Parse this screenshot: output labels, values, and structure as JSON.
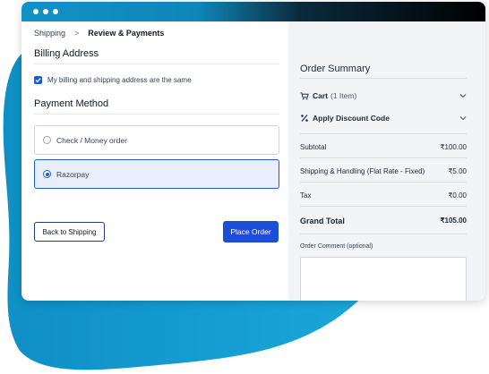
{
  "breadcrumb": {
    "step1": "Shipping",
    "separator": ">",
    "current": "Review & Payments"
  },
  "billing": {
    "title": "Billing Address",
    "same_address_label": "My billing and shipping address are the same",
    "same_address_checked": true
  },
  "payment": {
    "title": "Payment Method",
    "options": [
      {
        "label": "Check / Money order",
        "selected": false
      },
      {
        "label": "Razorpay",
        "selected": true
      }
    ]
  },
  "actions": {
    "back_label": "Back to Shipping",
    "place_order_label": "Place Order"
  },
  "summary": {
    "title": "Order Summary",
    "cart_label": "Cart",
    "cart_count": "(1 Item)",
    "discount_label": "Apply Discount Code",
    "lines": [
      {
        "label": "Subtotal",
        "value": "₹100.00"
      },
      {
        "label": "Shipping & Handling (Flat Rate - Fixed)",
        "value": "₹5.00"
      },
      {
        "label": "Tax",
        "value": "₹0.00"
      }
    ],
    "grand_total_label": "Grand Total",
    "grand_total_value": "₹105.00",
    "comment_label": "Order Comment (optional)",
    "comment_value": ""
  },
  "colors": {
    "accent": "#1d4ed8",
    "titlebar_start": "#1291c6",
    "titlebar_end": "#000000",
    "blob": "#0f8fc6"
  },
  "icons": [
    "cart-icon",
    "discount-icon",
    "chevron-down-icon",
    "check-icon",
    "chevron-right-icon"
  ]
}
